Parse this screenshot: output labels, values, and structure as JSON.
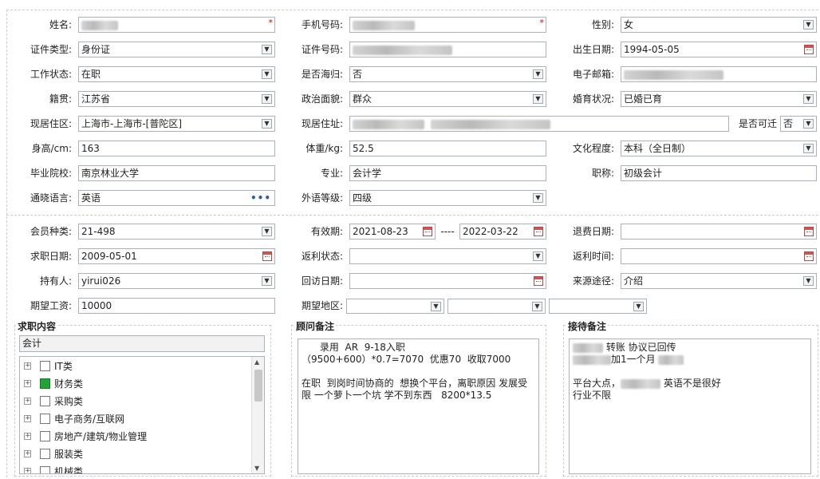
{
  "form": {
    "row1": {
      "name_label": "姓名:",
      "phone_label": "手机号码:",
      "gender_label": "性别:",
      "gender_value": "女",
      "required_mark": "*"
    },
    "row2": {
      "idtype_label": "证件类型:",
      "idtype_value": "身份证",
      "idno_label": "证件号码:",
      "birth_label": "出生日期:",
      "birth_value": "1994-05-05"
    },
    "row3": {
      "work_label": "工作状态:",
      "work_value": "在职",
      "overseas_label": "是否海归:",
      "overseas_value": "否",
      "email_label": "电子邮箱:"
    },
    "row4": {
      "native_label": "籍贯:",
      "native_value": "江苏省",
      "political_label": "政治面貌:",
      "political_value": "群众",
      "marital_label": "婚育状况:",
      "marital_value": "已婚已育"
    },
    "row5": {
      "region_label": "现居住区:",
      "region_value": "上海市-上海市-[普陀区]",
      "address_label": "现居住址:",
      "relocate_label": "是否可迁",
      "relocate_value": "否"
    },
    "row6": {
      "height_label": "身高/cm:",
      "height_value": "163",
      "weight_label": "体重/kg:",
      "weight_value": "52.5",
      "edu_label": "文化程度:",
      "edu_value": "本科（全日制）"
    },
    "row7": {
      "school_label": "毕业院校:",
      "school_value": "南京林业大学",
      "major_label": "专业:",
      "major_value": "会计学",
      "title_label": "职称:",
      "title_value": "初级会计"
    },
    "row8": {
      "lang_label": "通晓语言:",
      "lang_value": "英语",
      "lang_more": "•••",
      "level_label": "外语等级:",
      "level_value": "四级"
    }
  },
  "membership": {
    "type_label": "会员种类:",
    "type_value": "21-498",
    "valid_label": "有效期:",
    "valid_from": "2021-08-23",
    "valid_sep": "----",
    "valid_to": "2022-03-22",
    "refund_label": "退费日期:",
    "job_date_label": "求职日期:",
    "job_date_value": "2009-05-01",
    "rebate_status_label": "返利状态:",
    "rebate_time_label": "返利时间:",
    "holder_label": "持有人:",
    "holder_value": "yirui026",
    "visit_label": "回访日期:",
    "source_label": "来源途径:",
    "source_value": "介绍",
    "salary_label": "期望工资:",
    "salary_value": "10000",
    "area_label": "期望地区:"
  },
  "job_content": {
    "title": "求职内容",
    "selected": "会计",
    "items": [
      {
        "label": "IT类",
        "checked": false
      },
      {
        "label": "财务类",
        "checked": true
      },
      {
        "label": "采购类",
        "checked": false
      },
      {
        "label": "电子商务/互联网",
        "checked": false
      },
      {
        "label": "房地产/建筑/物业管理",
        "checked": false
      },
      {
        "label": "服装类",
        "checked": false
      },
      {
        "label": "机械类",
        "checked": false
      }
    ]
  },
  "advisor_notes": {
    "title": "顾问备注",
    "text": "      录用  AR  9-18入职\n（9500+600）*0.7=7070  优惠70  收取7000\n\n在职  到岗时间协商的  想换个平台，离职原因 发展受\n限 一个萝卜一个坑 学不到东西   8200*13.5"
  },
  "reception_notes": {
    "title": "接待备注",
    "line1": "转账 协议已回传",
    "line2": "加1一个月",
    "line3": "平台大点，",
    "line3b": "英语不是很好",
    "line4": "行业不限"
  }
}
